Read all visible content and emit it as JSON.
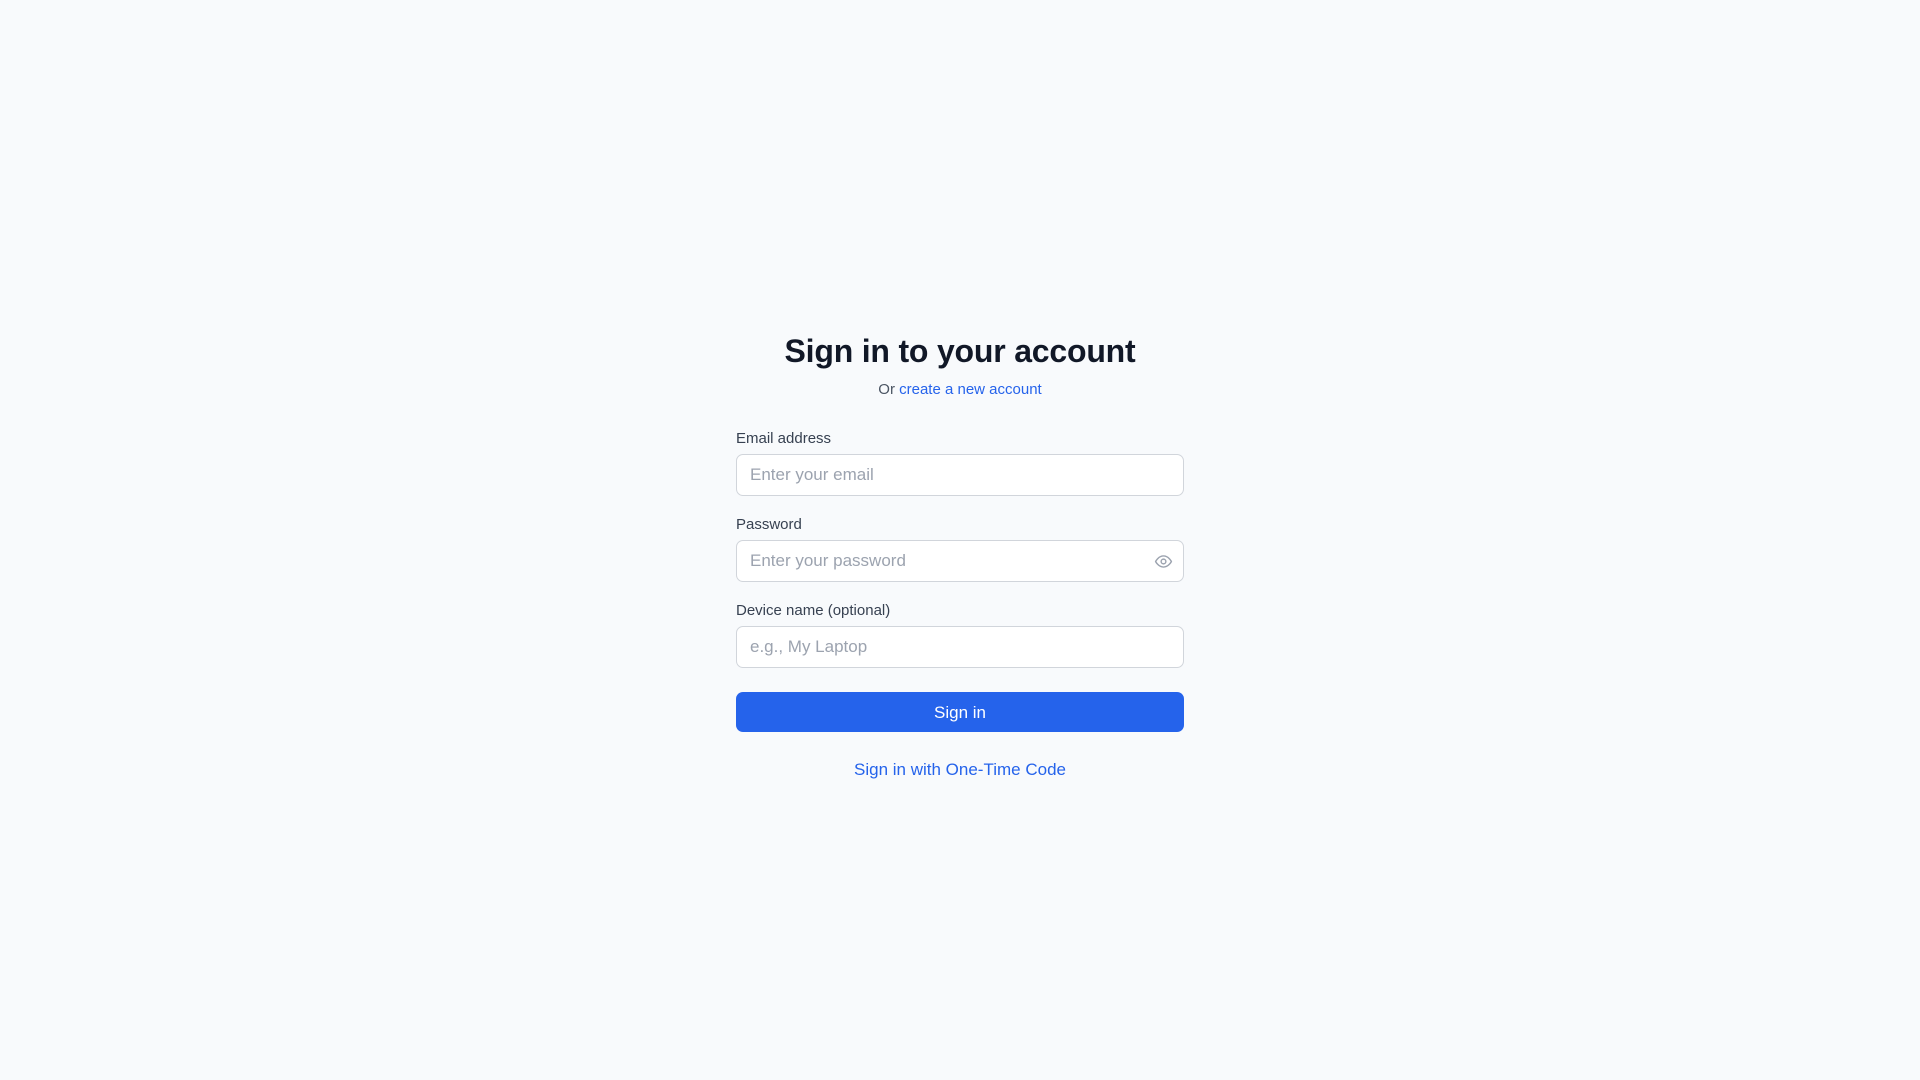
{
  "header": {
    "title": "Sign in to your account",
    "subtitle_prefix": "Or",
    "create_account_link": "create a new account"
  },
  "form": {
    "email": {
      "label": "Email address",
      "value": "",
      "placeholder": "Enter your email"
    },
    "password": {
      "label": "Password",
      "value": "",
      "placeholder": "Enter your password",
      "toggle_icon": "eye-icon"
    },
    "device": {
      "label": "Device name (optional)",
      "value": "",
      "placeholder": "e.g., My Laptop"
    },
    "submit_label": "Sign in",
    "otc_link": "Sign in with One-Time Code"
  },
  "colors": {
    "background": "#f8fafc",
    "accent": "#2563eb",
    "heading": "#111827",
    "input_border": "#d1d5db",
    "placeholder": "#9ca3af"
  }
}
